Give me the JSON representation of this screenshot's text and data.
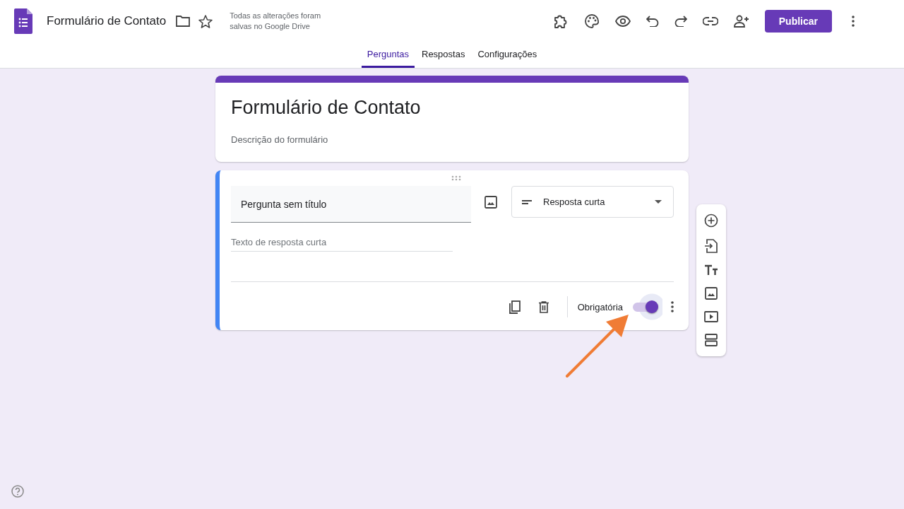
{
  "header": {
    "title": "Formulário de Contato",
    "save_status": "Todas as alterações foram salvas no Google Drive",
    "publish_button": "Publicar"
  },
  "tabs": [
    {
      "label": "Perguntas",
      "selected": true
    },
    {
      "label": "Respostas",
      "selected": false
    },
    {
      "label": "Configurações",
      "selected": false
    }
  ],
  "form": {
    "title": "Formulário de Contato",
    "description": "Descrição do formulário"
  },
  "question": {
    "title": "Pergunta sem título",
    "type": "Resposta curta",
    "answer_placeholder": "Texto de resposta curta",
    "required_label": "Obrigatória",
    "required": true
  }
}
